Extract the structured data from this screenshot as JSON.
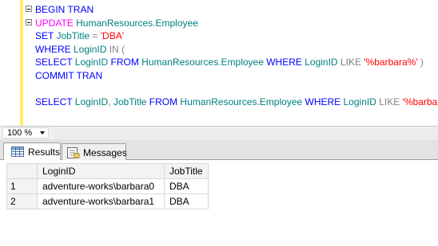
{
  "editor": {
    "lines": [
      [
        {
          "t": "BEGIN TRAN",
          "c": "kw"
        }
      ],
      [
        {
          "t": "UPDATE",
          "c": "kwm"
        },
        {
          "t": " HumanResources.Employee",
          "c": "obj"
        }
      ],
      [
        {
          "t": "SET",
          "c": "kw"
        },
        {
          "t": " JobTitle ",
          "c": "obj"
        },
        {
          "t": "=",
          "c": "op"
        },
        {
          "t": " ",
          "c": "pl"
        },
        {
          "t": "'DBA'",
          "c": "str"
        }
      ],
      [
        {
          "t": "WHERE",
          "c": "kw"
        },
        {
          "t": " LoginID ",
          "c": "obj"
        },
        {
          "t": "IN",
          "c": "op"
        },
        {
          "t": " (",
          "c": "op"
        }
      ],
      [
        {
          "t": "SELECT",
          "c": "kw"
        },
        {
          "t": " LoginID ",
          "c": "obj"
        },
        {
          "t": "FROM",
          "c": "kw"
        },
        {
          "t": " HumanResources.Employee ",
          "c": "obj"
        },
        {
          "t": "WHERE",
          "c": "kw"
        },
        {
          "t": " LoginID ",
          "c": "obj"
        },
        {
          "t": "LIKE",
          "c": "op"
        },
        {
          "t": " ",
          "c": "pl"
        },
        {
          "t": "'%barbara%'",
          "c": "str"
        },
        {
          "t": " )",
          "c": "op"
        }
      ],
      [
        {
          "t": "COMMIT TRAN",
          "c": "kw"
        }
      ],
      [],
      [
        {
          "t": "SELECT",
          "c": "kw"
        },
        {
          "t": " LoginID",
          "c": "obj"
        },
        {
          "t": ",",
          "c": "op"
        },
        {
          "t": " JobTitle ",
          "c": "obj"
        },
        {
          "t": "FROM",
          "c": "kw"
        },
        {
          "t": " HumanResources.Employee ",
          "c": "obj"
        },
        {
          "t": "WHERE",
          "c": "kw"
        },
        {
          "t": " LoginID ",
          "c": "obj"
        },
        {
          "t": "LIKE",
          "c": "op"
        },
        {
          "t": " ",
          "c": "pl"
        },
        {
          "t": "'%barbara%'",
          "c": "str"
        }
      ]
    ],
    "fold_lines": [
      0,
      1
    ]
  },
  "zoom": {
    "value": "100 %"
  },
  "tabs": {
    "results_label": "Results",
    "messages_label": "Messages"
  },
  "grid": {
    "columns": [
      "LoginID",
      "JobTitle"
    ],
    "rows": [
      {
        "num": "1",
        "LoginID": "adventure-works\\barbara0",
        "JobTitle": "DBA"
      },
      {
        "num": "2",
        "LoginID": "adventure-works\\barbara1",
        "JobTitle": "DBA"
      }
    ]
  },
  "colors": {
    "gutter_marker": "#ffee62",
    "keyword": "#0000ff",
    "keyword_dml": "#ff00ff",
    "object": "#008080",
    "string": "#ff0000",
    "operator": "#808080"
  },
  "icons": {
    "results_tab": "grid-icon",
    "messages_tab": "messages-icon",
    "zoom_dropdown": "chevron-down-icon"
  }
}
